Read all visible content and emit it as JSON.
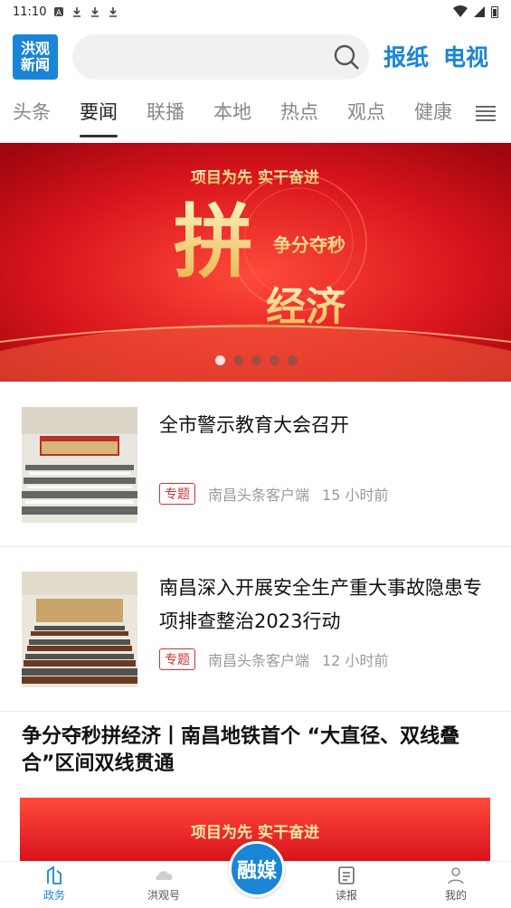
{
  "status": {
    "time": "11:10"
  },
  "header": {
    "logo_line1": "洪观",
    "logo_line2": "新闻",
    "search_placeholder": "",
    "link_paper": "报纸",
    "link_tv": "电视"
  },
  "tabs": [
    "头条",
    "要闻",
    "联播",
    "本地",
    "热点",
    "观点",
    "健康"
  ],
  "active_tab": "要闻",
  "banner": {
    "top_text": "项目为先 实干奋进",
    "main_char": "拼",
    "main_text": "经济",
    "side_text": "争分夺秒",
    "slides": 5,
    "current_slide": 1
  },
  "news": [
    {
      "title": "全市警示教育大会召开",
      "badge": "专题",
      "source": "南昌头条客户端",
      "time": "15 小时前"
    },
    {
      "title": "南昌深入开展安全生产重大事故隐患专项排查整治2023行动",
      "badge": "专题",
      "source": "南昌头条客户端",
      "time": "12 小时前"
    }
  ],
  "feature": {
    "title": "争分夺秒拼经济丨南昌地铁首个 “大直径、双线叠合”区间双线贯通",
    "card_text": "项目为先 实干奋进"
  },
  "bottom_nav": {
    "items": [
      "政务",
      "洪观号",
      "读报",
      "我的"
    ],
    "center_label": "融媒"
  },
  "colors": {
    "brand": "#1a84d6",
    "badge": "#d23232",
    "banner_red": "#d8141c"
  }
}
